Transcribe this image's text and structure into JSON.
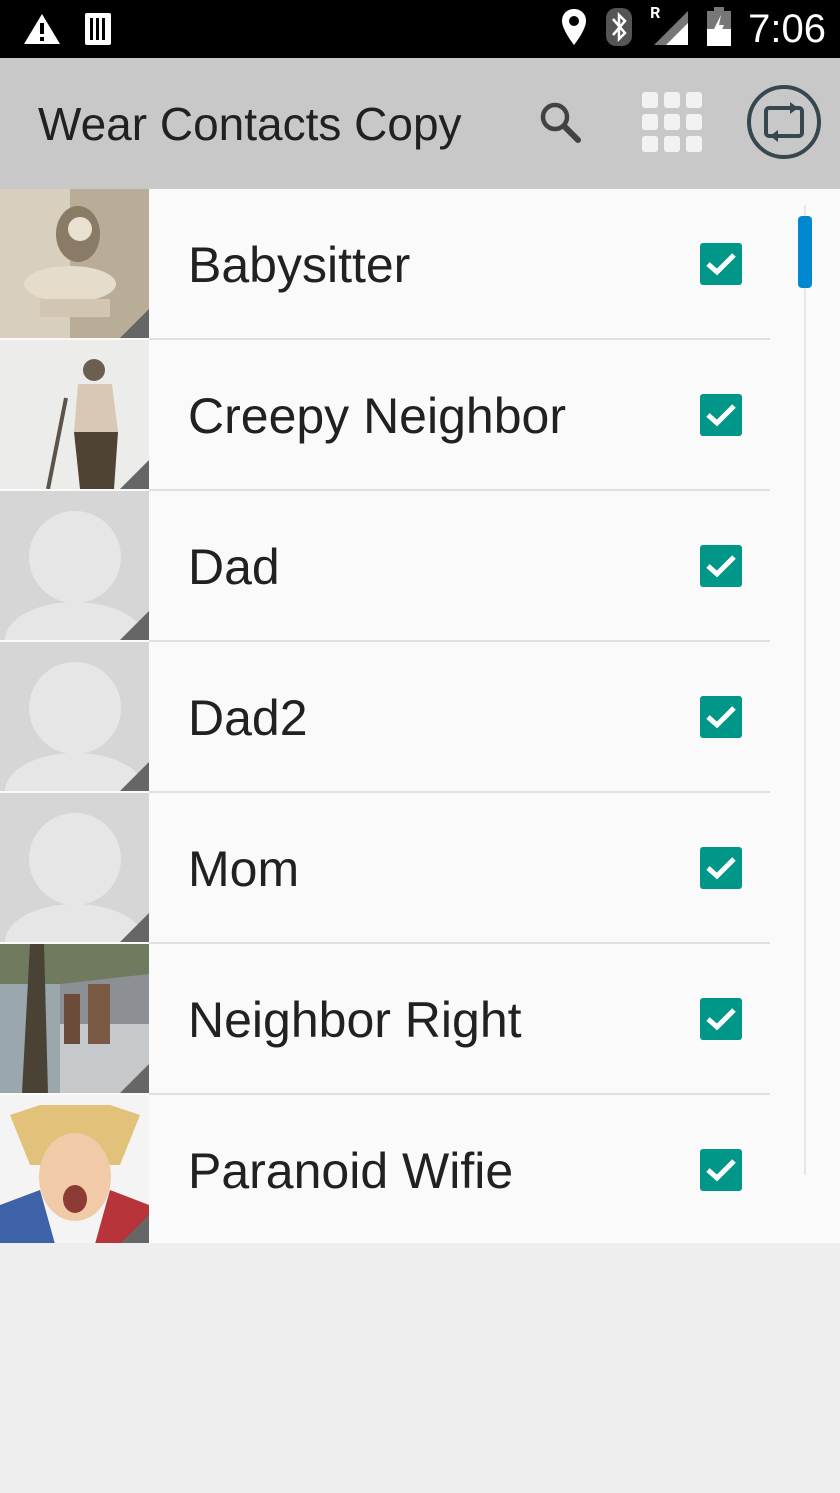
{
  "status_bar": {
    "time": "7:06",
    "icons": [
      "warning-icon",
      "sim-card-icon",
      "location-icon",
      "bluetooth-icon",
      "signal-roaming-icon",
      "battery-charging-icon"
    ],
    "roaming_label": "R"
  },
  "app_bar": {
    "title": "Wear Contacts Copy",
    "actions": [
      "search-icon",
      "grid-icon",
      "sync-icon"
    ]
  },
  "contacts": [
    {
      "name": "Babysitter",
      "checked": true,
      "photo": "photo-babysitter"
    },
    {
      "name": "Creepy Neighbor",
      "checked": true,
      "photo": "photo-creepy-neighbor"
    },
    {
      "name": "Dad",
      "checked": true,
      "photo": "default-avatar"
    },
    {
      "name": "Dad2",
      "checked": true,
      "photo": "default-avatar"
    },
    {
      "name": "Mom",
      "checked": true,
      "photo": "default-avatar"
    },
    {
      "name": "Neighbor Right",
      "checked": true,
      "photo": "photo-neighbor-right"
    },
    {
      "name": "Paranoid Wifie",
      "checked": true,
      "photo": "photo-paranoid-wifie"
    }
  ],
  "colors": {
    "accent": "#009688",
    "app_bar": "#c8c8c8",
    "scrollbar": "#0288d1",
    "list_bg": "#fafafa"
  }
}
